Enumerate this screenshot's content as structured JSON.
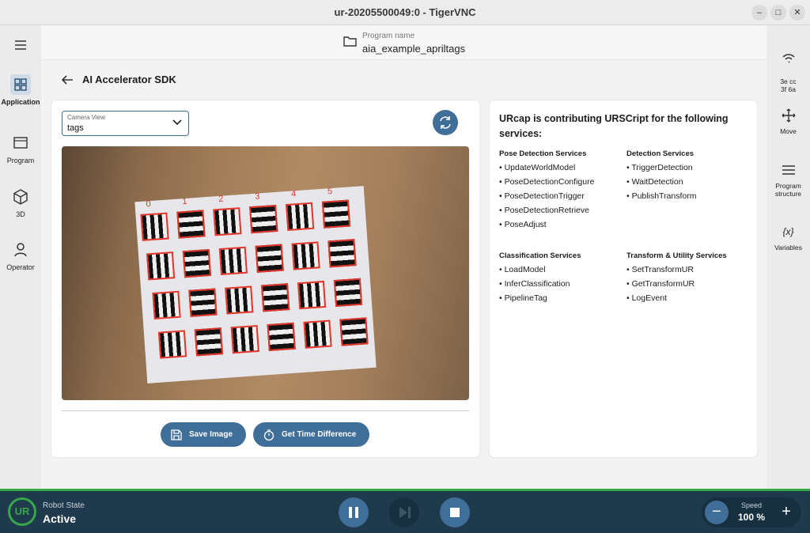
{
  "window": {
    "title": "ur-20205500049:0 - TigerVNC"
  },
  "left_nav": [
    {
      "label": "Application",
      "icon": "grid-icon",
      "active": true
    },
    {
      "label": "Program",
      "icon": "program-icon",
      "active": false
    },
    {
      "label": "3D",
      "icon": "cube-icon",
      "active": false
    },
    {
      "label": "Operator",
      "icon": "person-icon",
      "active": false
    }
  ],
  "right_nav": [
    {
      "label": "3e cc\n3f 6a",
      "icon": "wireless-icon"
    },
    {
      "label": "Move",
      "icon": "move-icon"
    },
    {
      "label": "Program structure",
      "icon": "list-icon"
    },
    {
      "label": "Variables",
      "icon": "variables-icon"
    }
  ],
  "header": {
    "program_label": "Program name",
    "program_name": "aia_example_apriltags"
  },
  "page": {
    "title": "AI Accelerator SDK"
  },
  "camera": {
    "select_label": "Camera View",
    "select_value": "tags",
    "tag_column_numbers": [
      "0",
      "1",
      "2",
      "3",
      "4",
      "5"
    ]
  },
  "buttons": {
    "save": "Save Image",
    "time": "Get Time Difference"
  },
  "services": {
    "title": "URcap is contributing URSCript for the following services:",
    "groups": [
      {
        "heading": "Pose Detection Services",
        "items": [
          "UpdateWorldModel",
          "PoseDetectionConfigure",
          "PoseDetectionTrigger",
          "PoseDetectionRetrieve",
          "PoseAdjust"
        ]
      },
      {
        "heading": "Detection Services",
        "items": [
          "TriggerDetection",
          "WaitDetection",
          "PublishTransform"
        ]
      },
      {
        "heading": "Classification Services",
        "items": [
          "LoadModel",
          "InferClassification",
          "PipelineTag"
        ]
      },
      {
        "heading": "Transform & Utility Services",
        "items": [
          "SetTransformUR",
          "GetTransformUR",
          "LogEvent"
        ]
      }
    ]
  },
  "footer": {
    "logo_text": "UR",
    "robot_state_label": "Robot State",
    "robot_state_value": "Active",
    "speed_label": "Speed",
    "speed_value": "100 %",
    "speed_minus": "−",
    "speed_plus": "+"
  },
  "colors": {
    "accent": "#3f6e99",
    "footer_bg": "#1f3a4d",
    "status_green": "#37a74a",
    "tag_outline": "#e3362a"
  }
}
